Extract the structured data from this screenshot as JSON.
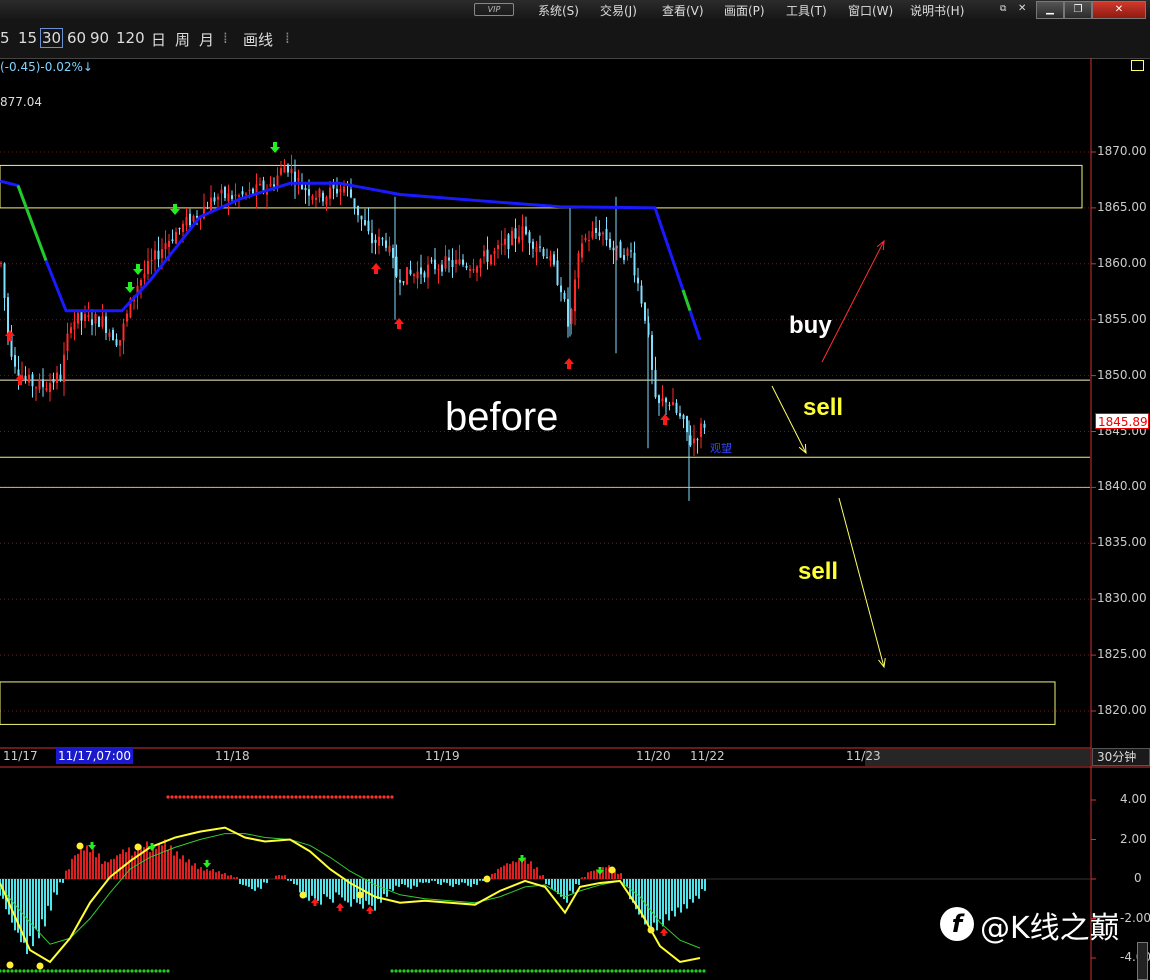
{
  "window": {
    "vip": "VIP",
    "menu": [
      "系统(S)",
      "交易(J)",
      "查看(V)",
      "画面(P)",
      "工具(T)",
      "窗口(W)",
      "说明书(H)"
    ],
    "buttons": {
      "minimize": "▁",
      "restore": "❐",
      "close": "✕"
    }
  },
  "toolbar": {
    "timeframes": [
      "5",
      "15",
      "30",
      "60",
      "90",
      "120",
      "日",
      "周",
      "月"
    ],
    "selected": "30",
    "draw": "画线",
    "sep": "⁞"
  },
  "chart": {
    "change_text": "(-0.45)-0.02%↓",
    "high_text": "877.04",
    "current_price": "1845.89",
    "watch_label": "观望",
    "period_label": "30分钟",
    "annotation_before": "before",
    "annotation_buy": "buy",
    "annotation_sell_1": "sell",
    "annotation_sell_2": "sell",
    "watermark": "@K线之巅",
    "watermark_logo": "f",
    "colors": {
      "up": "#ff2a2a",
      "down": "#7fdfff",
      "ma": "#1a1aff",
      "ma_up": "#22cc22",
      "zone": "#f2f27a",
      "level": "#f0b070"
    }
  },
  "chart_data": [
    {
      "type": "candlestick",
      "y_axis_ticks": [
        "1870.00",
        "1865.00",
        "1860.00",
        "1855.00",
        "1850.00",
        "1845.00",
        "1840.00",
        "1835.00",
        "1830.00",
        "1825.00",
        "1820.00"
      ],
      "ylim": [
        1818,
        1873
      ],
      "x_tick_labels": [
        "11/17",
        "11/17,07:00",
        "11/18",
        "11/19",
        "11/20",
        "11/22",
        "11/23"
      ],
      "current_price": 1845.89,
      "zones": [
        [
          1865,
          1868.8
        ],
        [
          1818.8,
          1822.6
        ]
      ],
      "levels": [
        1849.6,
        1842.7,
        1840.0
      ],
      "ma_points": [
        [
          0,
          1867.4
        ],
        [
          18,
          1867.0
        ],
        [
          46,
          1860.3
        ],
        [
          66,
          1855.8
        ],
        [
          122,
          1855.8
        ],
        [
          150,
          1858.5
        ],
        [
          200,
          1864.2
        ],
        [
          240,
          1865.8
        ],
        [
          290,
          1867.2
        ],
        [
          340,
          1867.2
        ],
        [
          400,
          1866.2
        ],
        [
          500,
          1865.5
        ],
        [
          560,
          1865.1
        ],
        [
          655,
          1865.0
        ],
        [
          700,
          1853.2
        ]
      ],
      "ma_green_segments": [
        [
          18,
          46
        ],
        [
          683,
          690
        ]
      ]
    },
    {
      "type": "macd",
      "y_axis_ticks": [
        "4.00",
        "2.00",
        "0",
        "-2.00",
        "-4.00"
      ],
      "ylim": [
        -4.5,
        5.2
      ],
      "histogram": [
        [
          0,
          -1.0
        ],
        [
          6,
          -1.8
        ],
        [
          12,
          -2.6
        ],
        [
          18,
          -3.2
        ],
        [
          24,
          -3.8
        ],
        [
          30,
          -3.4
        ],
        [
          36,
          -3.0
        ],
        [
          42,
          -2.4
        ],
        [
          48,
          -1.6
        ],
        [
          54,
          -0.8
        ],
        [
          60,
          -0.2
        ],
        [
          66,
          0.5
        ],
        [
          72,
          1.2
        ],
        [
          78,
          1.5
        ],
        [
          84,
          1.7
        ],
        [
          90,
          1.6
        ],
        [
          96,
          1.3
        ],
        [
          102,
          0.9
        ],
        [
          108,
          1.0
        ],
        [
          114,
          1.2
        ],
        [
          120,
          1.5
        ],
        [
          126,
          1.6
        ],
        [
          132,
          1.4
        ],
        [
          138,
          1.7
        ],
        [
          144,
          1.9
        ],
        [
          150,
          1.6
        ],
        [
          156,
          1.8
        ],
        [
          162,
          2.0
        ],
        [
          168,
          1.7
        ],
        [
          174,
          1.4
        ],
        [
          180,
          1.2
        ],
        [
          186,
          1.0
        ],
        [
          192,
          0.8
        ],
        [
          198,
          0.6
        ],
        [
          204,
          0.5
        ],
        [
          210,
          0.5
        ],
        [
          216,
          0.4
        ],
        [
          222,
          0.3
        ],
        [
          228,
          0.2
        ],
        [
          234,
          0.1
        ],
        [
          240,
          -0.3
        ],
        [
          246,
          -0.4
        ],
        [
          252,
          -0.6
        ],
        [
          258,
          -0.5
        ],
        [
          264,
          -0.2
        ],
        [
          270,
          0.0
        ],
        [
          276,
          0.2
        ],
        [
          282,
          0.2
        ],
        [
          288,
          -0.1
        ],
        [
          294,
          -0.3
        ],
        [
          300,
          -0.8
        ],
        [
          306,
          -1.1
        ],
        [
          312,
          -1.0
        ],
        [
          318,
          -1.3
        ],
        [
          324,
          -0.9
        ],
        [
          330,
          -1.2
        ],
        [
          336,
          -0.8
        ],
        [
          342,
          -1.1
        ],
        [
          348,
          -1.4
        ],
        [
          354,
          -1.2
        ],
        [
          360,
          -1.5
        ],
        [
          366,
          -1.3
        ],
        [
          372,
          -1.6
        ],
        [
          378,
          -1.2
        ],
        [
          384,
          -0.9
        ],
        [
          390,
          -0.6
        ],
        [
          396,
          -0.4
        ],
        [
          402,
          -0.3
        ],
        [
          408,
          -0.5
        ],
        [
          414,
          -0.4
        ],
        [
          420,
          -0.2
        ],
        [
          426,
          -0.2
        ],
        [
          432,
          -0.1
        ],
        [
          438,
          -0.3
        ],
        [
          444,
          -0.2
        ],
        [
          450,
          -0.4
        ],
        [
          456,
          -0.3
        ],
        [
          462,
          -0.2
        ],
        [
          468,
          -0.4
        ],
        [
          474,
          -0.3
        ],
        [
          480,
          -0.1
        ],
        [
          486,
          0.1
        ],
        [
          492,
          0.3
        ],
        [
          498,
          0.6
        ],
        [
          504,
          0.8
        ],
        [
          510,
          0.9
        ],
        [
          516,
          1.0
        ],
        [
          522,
          1.1
        ],
        [
          528,
          0.9
        ],
        [
          534,
          0.6
        ],
        [
          540,
          0.2
        ],
        [
          546,
          -0.3
        ],
        [
          552,
          -0.6
        ],
        [
          558,
          -0.9
        ],
        [
          564,
          -1.2
        ],
        [
          570,
          -0.7
        ],
        [
          576,
          -0.3
        ],
        [
          582,
          0.1
        ],
        [
          588,
          0.4
        ],
        [
          594,
          0.5
        ],
        [
          600,
          0.6
        ],
        [
          606,
          0.7
        ],
        [
          612,
          0.5
        ],
        [
          618,
          0.3
        ],
        [
          624,
          -0.4
        ],
        [
          630,
          -1.2
        ],
        [
          636,
          -1.8
        ],
        [
          642,
          -2.3
        ],
        [
          648,
          -2.7
        ],
        [
          654,
          -2.6
        ],
        [
          660,
          -2.4
        ],
        [
          666,
          -2.1
        ],
        [
          672,
          -1.9
        ],
        [
          678,
          -1.7
        ],
        [
          684,
          -1.5
        ],
        [
          690,
          -1.2
        ],
        [
          696,
          -1.0
        ],
        [
          702,
          -0.6
        ]
      ],
      "dif": [
        [
          0,
          -0.2
        ],
        [
          30,
          -3.6
        ],
        [
          50,
          -4.2
        ],
        [
          70,
          -3.0
        ],
        [
          90,
          -1.2
        ],
        [
          110,
          0.1
        ],
        [
          130,
          0.9
        ],
        [
          150,
          1.6
        ],
        [
          175,
          2.1
        ],
        [
          200,
          2.4
        ],
        [
          225,
          2.6
        ],
        [
          245,
          2.1
        ],
        [
          265,
          1.9
        ],
        [
          290,
          2.0
        ],
        [
          310,
          1.4
        ],
        [
          330,
          0.5
        ],
        [
          350,
          -0.2
        ],
        [
          375,
          -0.9
        ],
        [
          400,
          -1.2
        ],
        [
          425,
          -1.1
        ],
        [
          450,
          -1.2
        ],
        [
          475,
          -1.3
        ],
        [
          500,
          -0.6
        ],
        [
          525,
          -0.1
        ],
        [
          545,
          -0.4
        ],
        [
          565,
          -1.7
        ],
        [
          580,
          -0.4
        ],
        [
          600,
          -0.2
        ],
        [
          620,
          -0.1
        ],
        [
          640,
          -1.6
        ],
        [
          660,
          -3.4
        ],
        [
          680,
          -4.2
        ],
        [
          700,
          -4.0
        ]
      ],
      "dea": [
        [
          0,
          -0.4
        ],
        [
          30,
          -2.2
        ],
        [
          50,
          -3.3
        ],
        [
          70,
          -3.0
        ],
        [
          90,
          -2.0
        ],
        [
          110,
          -0.7
        ],
        [
          130,
          0.5
        ],
        [
          150,
          1.1
        ],
        [
          175,
          1.6
        ],
        [
          200,
          2.0
        ],
        [
          225,
          2.3
        ],
        [
          245,
          2.3
        ],
        [
          265,
          2.1
        ],
        [
          290,
          2.0
        ],
        [
          310,
          1.7
        ],
        [
          330,
          1.1
        ],
        [
          350,
          0.4
        ],
        [
          375,
          -0.3
        ],
        [
          400,
          -0.8
        ],
        [
          425,
          -1.0
        ],
        [
          450,
          -1.1
        ],
        [
          475,
          -1.2
        ],
        [
          500,
          -0.9
        ],
        [
          525,
          -0.4
        ],
        [
          545,
          -0.3
        ],
        [
          565,
          -0.9
        ],
        [
          580,
          -0.6
        ],
        [
          600,
          -0.3
        ],
        [
          620,
          -0.1
        ],
        [
          640,
          -0.9
        ],
        [
          660,
          -2.2
        ],
        [
          680,
          -3.1
        ],
        [
          700,
          -3.5
        ]
      ]
    }
  ]
}
